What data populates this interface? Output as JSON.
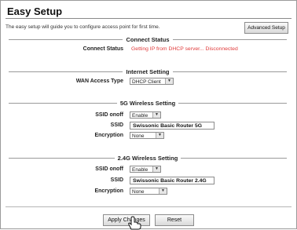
{
  "header": {
    "title": "Easy Setup",
    "intro": "The easy setup will guide you to configure access point for first time.",
    "advanced_label": "Advanced Setup"
  },
  "connect_status": {
    "heading": "Connect Status",
    "label": "Connect Status",
    "value": "Getting IP from DHCP server... Disconnected"
  },
  "internet": {
    "heading": "Internet Setting",
    "wan_label": "WAN Access Type",
    "wan_value": "DHCP Client"
  },
  "wireless_5g": {
    "heading": "5G Wireless Setting",
    "ssid_onoff_label": "SSID onoff",
    "ssid_onoff_value": "Enable",
    "ssid_label": "SSID",
    "ssid_value": "Swissonic Basic Router 5G",
    "encryption_label": "Encryption",
    "encryption_value": "None"
  },
  "wireless_24g": {
    "heading": "2.4G Wireless Setting",
    "ssid_onoff_label": "SSID onoff",
    "ssid_onoff_value": "Enable",
    "ssid_label": "SSID",
    "ssid_value": "Swissonic Basic Router 2.4G",
    "encryption_label": "Encryption",
    "encryption_value": "None"
  },
  "footer": {
    "apply_label": "Apply Changes",
    "reset_label": "Reset"
  },
  "colors": {
    "status_text": "#e03a3a"
  },
  "icons": {
    "dropdown": "chevron-down-icon",
    "cursor": "hand-pointer-icon"
  }
}
